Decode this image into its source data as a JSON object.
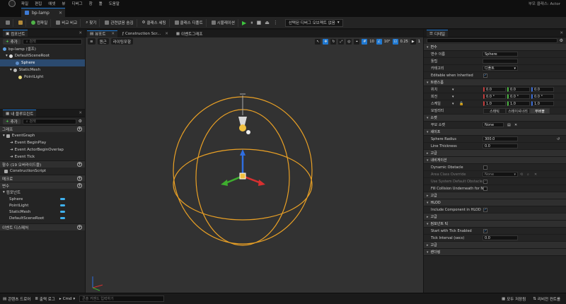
{
  "menu": {
    "items": [
      "파일",
      "편집",
      "에셋",
      "뷰",
      "디버그",
      "창",
      "툴",
      "도움말"
    ],
    "user": "부모 클래스: Actor"
  },
  "document_tab": {
    "title": "bp-lamp"
  },
  "toolbar": {
    "compile": "컴파일",
    "diff": "비교 비교",
    "find": "찾기",
    "hide_unrelated": "관련없음 숨김",
    "class_settings": "클래스 세팅",
    "class_defaults": "클래스 디폴트",
    "simulation": "시뮬레이션",
    "debug_object": "선택된 디버그 오브젝트 없음"
  },
  "components_panel": {
    "title": "컴포넌트",
    "add": "추가",
    "search_placeholder": "검색",
    "tree": [
      "bp-lamp (셀프)",
      "DefaultSceneRoot",
      "Sphere",
      "StaticMesh",
      "PointLight"
    ]
  },
  "my_blueprint": {
    "title": "내 블루프린트",
    "add": "추가",
    "search_placeholder": "검색",
    "graphs_label": "그래프",
    "event_graph": "EventGraph",
    "events": [
      "Event BeginPlay",
      "Event ActorBeginOverlap",
      "Event Tick"
    ],
    "functions_label": "함수 (19 오버라이드블)",
    "construction": "ConstructionScript",
    "macros_label": "매크로",
    "variables_label": "변수",
    "components_label": "컴포넌트",
    "variables": [
      "Sphere",
      "PointLight",
      "StaticMesh",
      "DefaultSceneRoot"
    ],
    "dispatchers_label": "이벤트 디스패처"
  },
  "viewport": {
    "tabs": [
      "뷰포트",
      "Construction Scr...",
      "이벤트그래프"
    ],
    "perspective": "원근",
    "lighting": "라이팅포함",
    "grid_snap": "10",
    "rot_snap": "10°",
    "scale_snap": "0.25",
    "camera_speed": "1"
  },
  "details": {
    "title": "디테일",
    "variable_section": "변수",
    "var_name_label": "변수 이름",
    "var_name": "Sphere",
    "tooltip_label": "툴팁",
    "category_label": "카테고리",
    "category": "디폴트",
    "editable_label": "Editable when Inherited",
    "transform_section": "트랜스폼",
    "location_label": "위치",
    "rotation_label": "회전",
    "scale_label": "스케일",
    "location": [
      "0.0",
      "0.0",
      "0.0"
    ],
    "rotation": [
      "0.0 °",
      "0.0 °",
      "0.0 °"
    ],
    "scale": [
      "1.0",
      "1.0",
      "1.0"
    ],
    "mobility_label": "모빌리티",
    "mobility": [
      "스태틱",
      "스테이셔너리",
      "무버블"
    ],
    "socket_section": "소켓",
    "parent_socket_label": "부모 소켓",
    "parent_socket": "None",
    "shape_section": "셰이프",
    "sphere_radius_label": "Sphere Radius",
    "sphere_radius": "300.0",
    "line_thickness_label": "Line Thickness",
    "line_thickness": "0.0",
    "advanced": "고급",
    "navigation_section": "내비게이션",
    "dynamic_obstacle_label": "Dynamic Obstacle",
    "area_class_label": "Area Class Override",
    "area_class": "None",
    "use_system_label": "Use System Default Obstacle...",
    "fill_collision_label": "Fill Collision Underneath for N...",
    "hlod_section": "HLOD",
    "include_hlod_label": "Include Component in HLOD",
    "tick_section": "컴포넌트 틱",
    "start_tick_label": "Start with Tick Enabled",
    "tick_interval_label": "Tick Interval (secs)",
    "tick_interval": "0.0",
    "rendering_section": "렌더링"
  },
  "status": {
    "content_drawer": "콘텐츠 드로어",
    "output_log": "출력 로그",
    "cmd": "Cmd",
    "console_placeholder": "콘솔 커맨드 입력하기",
    "save_all": "모두 저장됨",
    "revision": "리비전 컨트롤"
  }
}
